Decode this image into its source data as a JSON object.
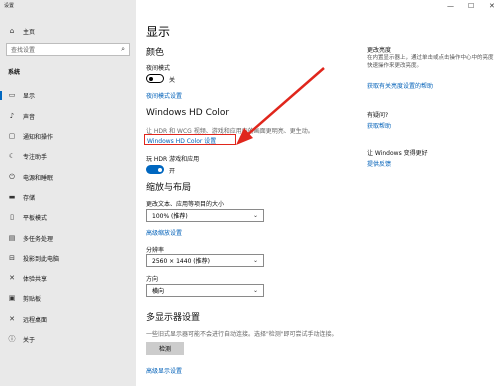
{
  "window": {
    "title": "设置"
  },
  "sidebar": {
    "home_label": "主页",
    "search_placeholder": "查找设置",
    "section_label": "系统",
    "items": [
      {
        "icon": "monitor-icon",
        "label": "显示"
      },
      {
        "icon": "speaker-icon",
        "label": "声音"
      },
      {
        "icon": "message-icon",
        "label": "通知和操作"
      },
      {
        "icon": "moon-icon",
        "label": "专注助手"
      },
      {
        "icon": "power-icon",
        "label": "电源和睡眠"
      },
      {
        "icon": "storage-icon",
        "label": "存储"
      },
      {
        "icon": "tablet-icon",
        "label": "平板模式"
      },
      {
        "icon": "multitask-icon",
        "label": "多任务处理"
      },
      {
        "icon": "project-icon",
        "label": "投影到此电脑"
      },
      {
        "icon": "share-icon",
        "label": "体验共享"
      },
      {
        "icon": "clipboard-icon",
        "label": "剪贴板"
      },
      {
        "icon": "remote-icon",
        "label": "远程桌面"
      },
      {
        "icon": "info-icon",
        "label": "关于"
      }
    ]
  },
  "main": {
    "page_title": "显示",
    "color_heading": "颜色",
    "night_light_label": "夜间模式",
    "night_light_state": "关",
    "night_light_link": "夜间模式设置",
    "hdr_heading": "Windows HD Color",
    "hdr_desc": "让 HDR 和 WCG 视频、游戏和应用中的画面更明亮、更生动。",
    "hdr_link": "Windows HD Color 设置",
    "hdr_games_label": "玩 HDR 游戏和应用",
    "hdr_games_state": "开",
    "scale_heading": "缩放与布局",
    "scale_label": "更改文本、应用等项目的大小",
    "scale_value": "100% (推荐)",
    "advanced_scale_link": "高级缩放设置",
    "resolution_label": "分辨率",
    "resolution_value": "2560 × 1440 (推荐)",
    "orientation_label": "方向",
    "orientation_value": "横向",
    "multi_heading": "多显示器设置",
    "multi_desc": "一些旧式显示器可能不会进行自动连接。选择\"检测\"即可尝试手动连接。",
    "detect_button": "检测",
    "advanced_display_link": "高级显示设置"
  },
  "right": {
    "brightness_title": "更改亮度",
    "brightness_text": "在内置显示器上，通过单击或点击操作中心中的亮度快速操作来更改亮度。",
    "brightness_link": "获取有关亮度设置的帮助",
    "question_title": "有疑问?",
    "help_link": "获取帮助",
    "improve_title": "让 Windows 变得更好",
    "feedback_link": "提供反馈"
  },
  "colors": {
    "accent": "#0067c0",
    "highlight": "#e0261c",
    "sidebar_bg": "#e9e9e9"
  }
}
